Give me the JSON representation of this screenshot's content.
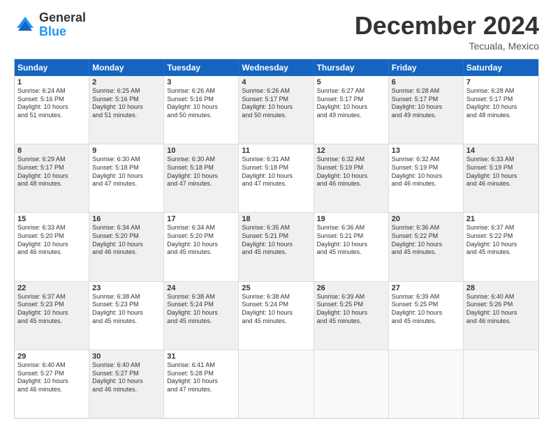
{
  "logo": {
    "general": "General",
    "blue": "Blue"
  },
  "title": "December 2024",
  "location": "Tecuala, Mexico",
  "header_days": [
    "Sunday",
    "Monday",
    "Tuesday",
    "Wednesday",
    "Thursday",
    "Friday",
    "Saturday"
  ],
  "rows": [
    [
      {
        "day": "1",
        "lines": [
          "Sunrise: 6:24 AM",
          "Sunset: 5:16 PM",
          "Daylight: 10 hours",
          "and 51 minutes."
        ],
        "shade": false
      },
      {
        "day": "2",
        "lines": [
          "Sunrise: 6:25 AM",
          "Sunset: 5:16 PM",
          "Daylight: 10 hours",
          "and 51 minutes."
        ],
        "shade": true
      },
      {
        "day": "3",
        "lines": [
          "Sunrise: 6:26 AM",
          "Sunset: 5:16 PM",
          "Daylight: 10 hours",
          "and 50 minutes."
        ],
        "shade": false
      },
      {
        "day": "4",
        "lines": [
          "Sunrise: 6:26 AM",
          "Sunset: 5:17 PM",
          "Daylight: 10 hours",
          "and 50 minutes."
        ],
        "shade": true
      },
      {
        "day": "5",
        "lines": [
          "Sunrise: 6:27 AM",
          "Sunset: 5:17 PM",
          "Daylight: 10 hours",
          "and 49 minutes."
        ],
        "shade": false
      },
      {
        "day": "6",
        "lines": [
          "Sunrise: 6:28 AM",
          "Sunset: 5:17 PM",
          "Daylight: 10 hours",
          "and 49 minutes."
        ],
        "shade": true
      },
      {
        "day": "7",
        "lines": [
          "Sunrise: 6:28 AM",
          "Sunset: 5:17 PM",
          "Daylight: 10 hours",
          "and 48 minutes."
        ],
        "shade": false
      }
    ],
    [
      {
        "day": "8",
        "lines": [
          "Sunrise: 6:29 AM",
          "Sunset: 5:17 PM",
          "Daylight: 10 hours",
          "and 48 minutes."
        ],
        "shade": true
      },
      {
        "day": "9",
        "lines": [
          "Sunrise: 6:30 AM",
          "Sunset: 5:18 PM",
          "Daylight: 10 hours",
          "and 47 minutes."
        ],
        "shade": false
      },
      {
        "day": "10",
        "lines": [
          "Sunrise: 6:30 AM",
          "Sunset: 5:18 PM",
          "Daylight: 10 hours",
          "and 47 minutes."
        ],
        "shade": true
      },
      {
        "day": "11",
        "lines": [
          "Sunrise: 6:31 AM",
          "Sunset: 5:18 PM",
          "Daylight: 10 hours",
          "and 47 minutes."
        ],
        "shade": false
      },
      {
        "day": "12",
        "lines": [
          "Sunrise: 6:32 AM",
          "Sunset: 5:19 PM",
          "Daylight: 10 hours",
          "and 46 minutes."
        ],
        "shade": true
      },
      {
        "day": "13",
        "lines": [
          "Sunrise: 6:32 AM",
          "Sunset: 5:19 PM",
          "Daylight: 10 hours",
          "and 46 minutes."
        ],
        "shade": false
      },
      {
        "day": "14",
        "lines": [
          "Sunrise: 6:33 AM",
          "Sunset: 5:19 PM",
          "Daylight: 10 hours",
          "and 46 minutes."
        ],
        "shade": true
      }
    ],
    [
      {
        "day": "15",
        "lines": [
          "Sunrise: 6:33 AM",
          "Sunset: 5:20 PM",
          "Daylight: 10 hours",
          "and 46 minutes."
        ],
        "shade": false
      },
      {
        "day": "16",
        "lines": [
          "Sunrise: 6:34 AM",
          "Sunset: 5:20 PM",
          "Daylight: 10 hours",
          "and 46 minutes."
        ],
        "shade": true
      },
      {
        "day": "17",
        "lines": [
          "Sunrise: 6:34 AM",
          "Sunset: 5:20 PM",
          "Daylight: 10 hours",
          "and 45 minutes."
        ],
        "shade": false
      },
      {
        "day": "18",
        "lines": [
          "Sunrise: 6:35 AM",
          "Sunset: 5:21 PM",
          "Daylight: 10 hours",
          "and 45 minutes."
        ],
        "shade": true
      },
      {
        "day": "19",
        "lines": [
          "Sunrise: 6:36 AM",
          "Sunset: 5:21 PM",
          "Daylight: 10 hours",
          "and 45 minutes."
        ],
        "shade": false
      },
      {
        "day": "20",
        "lines": [
          "Sunrise: 6:36 AM",
          "Sunset: 5:22 PM",
          "Daylight: 10 hours",
          "and 45 minutes."
        ],
        "shade": true
      },
      {
        "day": "21",
        "lines": [
          "Sunrise: 6:37 AM",
          "Sunset: 5:22 PM",
          "Daylight: 10 hours",
          "and 45 minutes."
        ],
        "shade": false
      }
    ],
    [
      {
        "day": "22",
        "lines": [
          "Sunrise: 6:37 AM",
          "Sunset: 5:23 PM",
          "Daylight: 10 hours",
          "and 45 minutes."
        ],
        "shade": true
      },
      {
        "day": "23",
        "lines": [
          "Sunrise: 6:38 AM",
          "Sunset: 5:23 PM",
          "Daylight: 10 hours",
          "and 45 minutes."
        ],
        "shade": false
      },
      {
        "day": "24",
        "lines": [
          "Sunrise: 6:38 AM",
          "Sunset: 5:24 PM",
          "Daylight: 10 hours",
          "and 45 minutes."
        ],
        "shade": true
      },
      {
        "day": "25",
        "lines": [
          "Sunrise: 6:38 AM",
          "Sunset: 5:24 PM",
          "Daylight: 10 hours",
          "and 45 minutes."
        ],
        "shade": false
      },
      {
        "day": "26",
        "lines": [
          "Sunrise: 6:39 AM",
          "Sunset: 5:25 PM",
          "Daylight: 10 hours",
          "and 45 minutes."
        ],
        "shade": true
      },
      {
        "day": "27",
        "lines": [
          "Sunrise: 6:39 AM",
          "Sunset: 5:25 PM",
          "Daylight: 10 hours",
          "and 45 minutes."
        ],
        "shade": false
      },
      {
        "day": "28",
        "lines": [
          "Sunrise: 6:40 AM",
          "Sunset: 5:26 PM",
          "Daylight: 10 hours",
          "and 46 minutes."
        ],
        "shade": true
      }
    ],
    [
      {
        "day": "29",
        "lines": [
          "Sunrise: 6:40 AM",
          "Sunset: 5:27 PM",
          "Daylight: 10 hours",
          "and 46 minutes."
        ],
        "shade": false
      },
      {
        "day": "30",
        "lines": [
          "Sunrise: 6:40 AM",
          "Sunset: 5:27 PM",
          "Daylight: 10 hours",
          "and 46 minutes."
        ],
        "shade": true
      },
      {
        "day": "31",
        "lines": [
          "Sunrise: 6:41 AM",
          "Sunset: 5:28 PM",
          "Daylight: 10 hours",
          "and 47 minutes."
        ],
        "shade": false
      },
      {
        "day": "",
        "lines": [],
        "shade": true,
        "empty": true
      },
      {
        "day": "",
        "lines": [],
        "shade": false,
        "empty": true
      },
      {
        "day": "",
        "lines": [],
        "shade": true,
        "empty": true
      },
      {
        "day": "",
        "lines": [],
        "shade": false,
        "empty": true
      }
    ]
  ]
}
